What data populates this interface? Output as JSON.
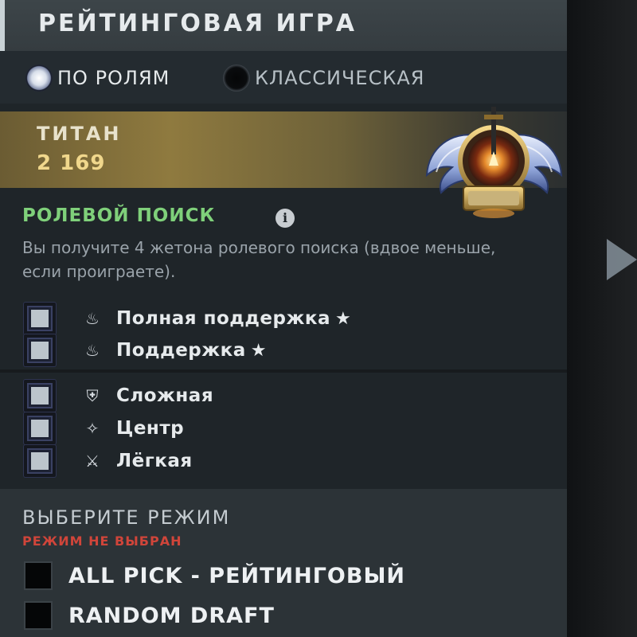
{
  "header": {
    "title": "РЕЙТИНГОВАЯ ИГРА"
  },
  "matchmaking_modes": [
    {
      "label": "ПО РОЛЯМ",
      "selected": true
    },
    {
      "label": "КЛАССИЧЕСКАЯ",
      "selected": false
    }
  ],
  "rank": {
    "name": "ТИТАН",
    "value": "2 169"
  },
  "role_search": {
    "title": "РОЛЕВОЙ ПОИСК",
    "description": "Вы получите 4 жетона ролевого поиска (вдвое меньше, если проиграете).",
    "roles": [
      {
        "label": "Полная поддержка",
        "icon": "hard-support-icon",
        "starred": true,
        "checked": false
      },
      {
        "label": "Поддержка",
        "icon": "support-icon",
        "starred": true,
        "checked": false
      },
      {
        "label": "Сложная",
        "icon": "offlane-icon",
        "starred": false,
        "checked": false
      },
      {
        "label": "Центр",
        "icon": "mid-icon",
        "starred": false,
        "checked": false
      },
      {
        "label": "Лёгкая",
        "icon": "safelane-icon",
        "starred": false,
        "checked": false
      }
    ]
  },
  "game_mode": {
    "heading": "ВЫБЕРИТЕ РЕЖИМ",
    "warning": "РЕЖИМ НЕ ВЫБРАН",
    "options": [
      {
        "label": "ALL PICK - РЕЙТИНГОВЫЙ",
        "checked": false
      },
      {
        "label": "RANDOM DRAFT",
        "checked": false
      }
    ]
  },
  "colors": {
    "accent_green": "#7fd07a",
    "warning_red": "#d0453a",
    "rank_gold": "#f0d78c"
  }
}
